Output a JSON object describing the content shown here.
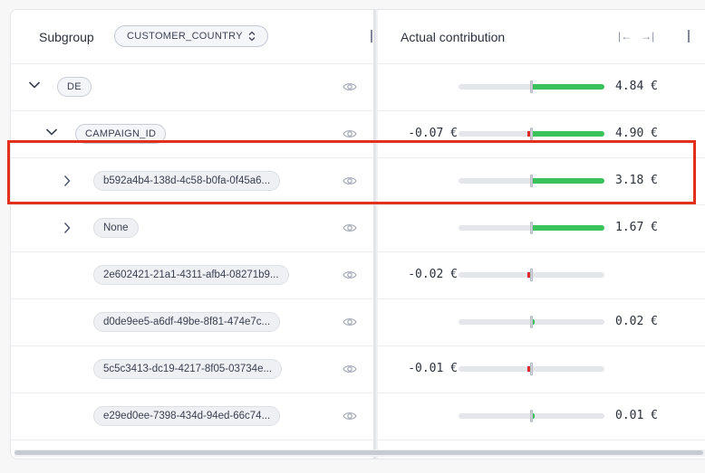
{
  "header": {
    "subgroup_label": "Subgroup",
    "dimension_selector": "CUSTOMER_COUNTRY",
    "contribution_label": "Actual contribution",
    "collapse_left": "|←",
    "collapse_right": "→|"
  },
  "rows": [
    {
      "level": 0,
      "chevron": "down",
      "label": "DE",
      "kind": "dim",
      "neg": "",
      "pos": "4.84 €",
      "neg_fraction": 0,
      "pos_fraction": 1.0
    },
    {
      "level": 1,
      "chevron": "down",
      "label": "CAMPAIGN_ID",
      "kind": "dim",
      "neg": "-0.07 €",
      "pos": "4.90 €",
      "neg_fraction": 0.04,
      "pos_fraction": 1.0
    },
    {
      "level": 2,
      "chevron": "right",
      "label": "b592a4b4-138d-4c58-b0fa-0f45a6...",
      "kind": "id",
      "neg": "",
      "pos": "3.18 €",
      "neg_fraction": 0,
      "pos_fraction": 1.0
    },
    {
      "level": 2,
      "chevron": "right",
      "label": "None",
      "kind": "id",
      "neg": "",
      "pos": "1.67 €",
      "neg_fraction": 0,
      "pos_fraction": 1.0
    },
    {
      "level": 2,
      "chevron": "",
      "label": "2e602421-21a1-4311-afb4-08271b9...",
      "kind": "id",
      "neg": "-0.02 €",
      "pos": "",
      "neg_fraction": 0.02,
      "pos_fraction": 0
    },
    {
      "level": 2,
      "chevron": "",
      "label": "d0de9ee5-a6df-49be-8f81-474e7c...",
      "kind": "id",
      "neg": "",
      "pos": "0.02 €",
      "neg_fraction": 0,
      "pos_fraction": 0.01
    },
    {
      "level": 2,
      "chevron": "",
      "label": "5c5c3413-dc19-4217-8f05-03734e...",
      "kind": "id",
      "neg": "-0.01 €",
      "pos": "",
      "neg_fraction": 0.02,
      "pos_fraction": 0
    },
    {
      "level": 2,
      "chevron": "",
      "label": "e29ed0ee-7398-434d-94ed-66c74...",
      "kind": "id",
      "neg": "",
      "pos": "0.01 €",
      "neg_fraction": 0,
      "pos_fraction": 0.01
    }
  ],
  "highlighted_row_index": 2,
  "colors": {
    "positive": "#3cc25a",
    "negative": "#e02a2a",
    "highlight": "#e3301d"
  }
}
